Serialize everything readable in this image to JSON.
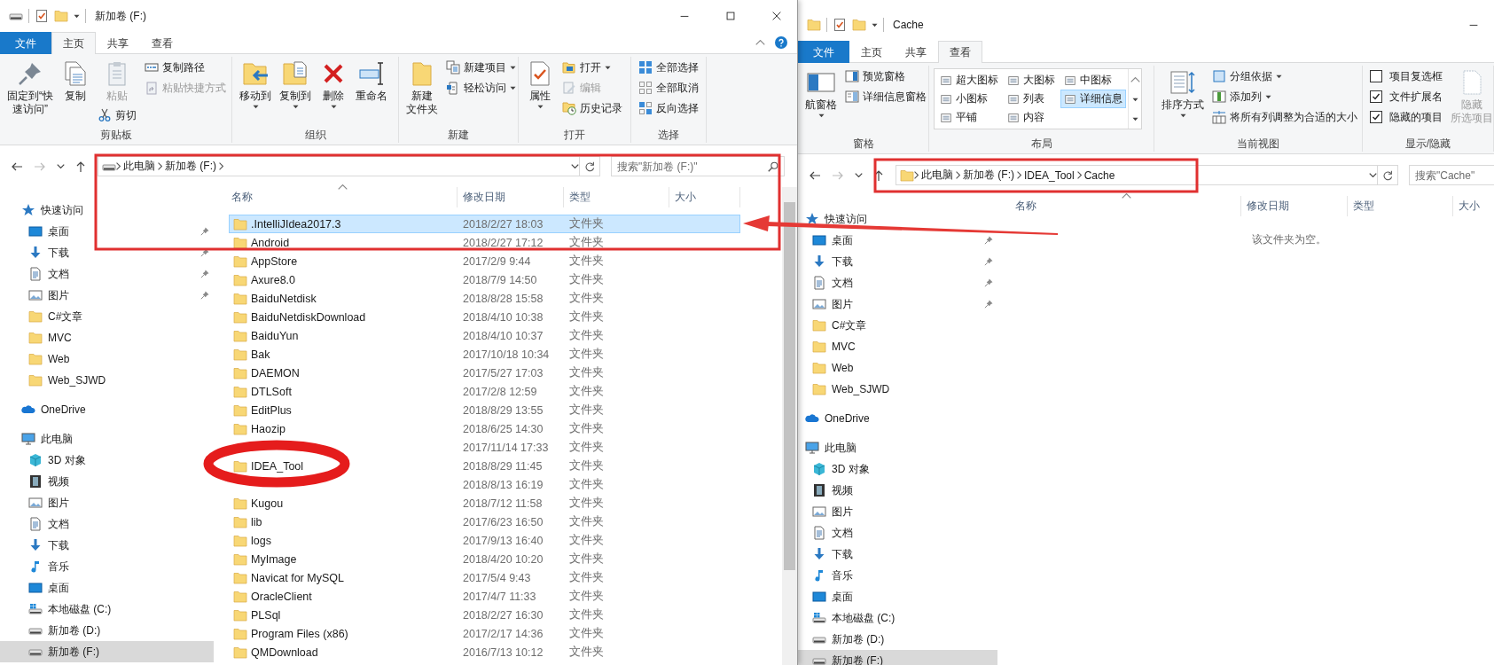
{
  "left_window": {
    "title": "新加卷 (F:)",
    "kind": "drive",
    "controls": [
      {
        "kind": "minimize"
      },
      {
        "kind": "maximize"
      },
      {
        "kind": "close"
      }
    ],
    "show_help": true,
    "tabs": [
      {
        "label": "文件",
        "kind": "file",
        "selected": false
      },
      {
        "label": "主页",
        "kind": "tab",
        "selected": true
      },
      {
        "label": "共享",
        "kind": "tab",
        "selected": false
      },
      {
        "label": "查看",
        "kind": "tab",
        "selected": false
      }
    ],
    "ribbon": [
      {
        "label": "剪贴板",
        "columns": [
          [
            {
              "lines": [
                "固定到“快",
                "速访问”"
              ],
              "kind": "large",
              "dropdown": false,
              "disabled": false
            }
          ],
          [
            {
              "label": "复制",
              "kind": "large",
              "dropdown": false,
              "disabled": false
            }
          ],
          [
            {
              "label": "粘贴",
              "kind": "large",
              "dropdown": false,
              "disabled": true
            },
            {
              "label": "剪切",
              "kind": "small",
              "dropdown": false,
              "disabled": false
            }
          ],
          [
            {
              "label": "复制路径",
              "kind": "small",
              "dropdown": false,
              "disabled": false
            },
            {
              "label": "粘贴快捷方式",
              "kind": "small",
              "dropdown": false,
              "disabled": true
            }
          ]
        ]
      },
      {
        "label": "组织",
        "columns": [
          [
            {
              "label": "移动到",
              "kind": "large",
              "dropdown": true,
              "disabled": false
            }
          ],
          [
            {
              "label": "复制到",
              "kind": "large",
              "dropdown": true,
              "disabled": false
            }
          ],
          [
            {
              "label": "删除",
              "kind": "large",
              "dropdown": true,
              "disabled": false
            }
          ],
          [
            {
              "label": "重命名",
              "kind": "large",
              "dropdown": false,
              "disabled": false
            }
          ]
        ]
      },
      {
        "label": "新建",
        "columns": [
          [
            {
              "lines": [
                "新建",
                "文件夹"
              ],
              "kind": "large",
              "dropdown": false,
              "disabled": false
            }
          ],
          [
            {
              "label": "新建项目",
              "kind": "small",
              "dropdown": true,
              "disabled": false
            },
            {
              "label": "轻松访问",
              "kind": "small",
              "dropdown": true,
              "disabled": false
            }
          ]
        ]
      },
      {
        "label": "打开",
        "columns": [
          [
            {
              "label": "属性",
              "kind": "large",
              "dropdown": true,
              "disabled": false
            }
          ],
          [
            {
              "label": "打开",
              "kind": "small",
              "dropdown": true,
              "disabled": false
            },
            {
              "label": "编辑",
              "kind": "small",
              "dropdown": false,
              "disabled": true
            },
            {
              "label": "历史记录",
              "kind": "small",
              "dropdown": false,
              "disabled": false
            }
          ]
        ]
      },
      {
        "label": "选择",
        "columns": [
          [
            {
              "label": "全部选择",
              "kind": "small",
              "dropdown": false,
              "disabled": false
            },
            {
              "label": "全部取消",
              "kind": "small",
              "dropdown": false,
              "disabled": false
            },
            {
              "label": "反向选择",
              "kind": "small",
              "dropdown": false,
              "disabled": false
            }
          ]
        ]
      }
    ],
    "address": {
      "crumbs": [
        "此电脑",
        "新加卷 (F:)"
      ],
      "trailing_chevron": true
    },
    "search": {
      "placeholder": "搜索\"新加卷 (F:)\""
    },
    "sidebar": [
      {
        "label": "快速访问",
        "kind": "quick-access",
        "selected": false,
        "pinned": false,
        "children": [
          {
            "label": "桌面",
            "kind": "desktop",
            "selected": false,
            "pinned": true
          },
          {
            "label": "下载",
            "kind": "downloads",
            "selected": false,
            "pinned": true
          },
          {
            "label": "文档",
            "kind": "documents",
            "selected": false,
            "pinned": true
          },
          {
            "label": "图片",
            "kind": "pictures",
            "selected": false,
            "pinned": true
          },
          {
            "label": "C#文章",
            "kind": "folder",
            "selected": false,
            "pinned": false
          },
          {
            "label": "MVC",
            "kind": "folder",
            "selected": false,
            "pinned": false
          },
          {
            "label": "Web",
            "kind": "folder",
            "selected": false,
            "pinned": false
          },
          {
            "label": "Web_SJWD",
            "kind": "folder",
            "selected": false,
            "pinned": false
          }
        ]
      },
      {
        "label": "OneDrive",
        "kind": "onedrive",
        "selected": false,
        "pinned": false
      },
      {
        "label": "此电脑",
        "kind": "computer",
        "selected": false,
        "pinned": false,
        "children": [
          {
            "label": "3D 对象",
            "kind": "objects",
            "selected": false,
            "pinned": false
          },
          {
            "label": "视频",
            "kind": "videos",
            "selected": false,
            "pinned": false
          },
          {
            "label": "图片",
            "kind": "pictures",
            "selected": false,
            "pinned": false
          },
          {
            "label": "文档",
            "kind": "documents",
            "selected": false,
            "pinned": false
          },
          {
            "label": "下载",
            "kind": "downloads",
            "selected": false,
            "pinned": false
          },
          {
            "label": "音乐",
            "kind": "music",
            "selected": false,
            "pinned": false
          },
          {
            "label": "桌面",
            "kind": "desktop",
            "selected": false,
            "pinned": false
          },
          {
            "label": "本地磁盘 (C:)",
            "kind": "sysdrive",
            "selected": false,
            "pinned": false
          },
          {
            "label": "新加卷 (D:)",
            "kind": "drive",
            "selected": false,
            "pinned": false
          },
          {
            "label": "新加卷 (F:)",
            "kind": "drive",
            "selected": true,
            "pinned": false
          }
        ]
      }
    ],
    "columns": [
      {
        "label": "名称",
        "sorted": true
      },
      {
        "label": "修改日期",
        "sorted": false
      },
      {
        "label": "类型",
        "sorted": false
      },
      {
        "label": "大小",
        "sorted": false
      }
    ],
    "rows": [
      {
        "name": ".IntelliJIdea2017.3",
        "modified": "2018/2/27 18:03",
        "type": "文件夹",
        "selected": true
      },
      {
        "name": "Android",
        "modified": "2018/2/27 17:12",
        "type": "文件夹",
        "selected": false
      },
      {
        "name": "AppStore",
        "modified": "2017/2/9 9:44",
        "type": "文件夹",
        "selected": false
      },
      {
        "name": "Axure8.0",
        "modified": "2018/7/9 14:50",
        "type": "文件夹",
        "selected": false
      },
      {
        "name": "BaiduNetdisk",
        "modified": "2018/8/28 15:58",
        "type": "文件夹",
        "selected": false
      },
      {
        "name": "BaiduNetdiskDownload",
        "modified": "2018/4/10 10:38",
        "type": "文件夹",
        "selected": false
      },
      {
        "name": "BaiduYun",
        "modified": "2018/4/10 10:37",
        "type": "文件夹",
        "selected": false
      },
      {
        "name": "Bak",
        "modified": "2017/10/18 10:34",
        "type": "文件夹",
        "selected": false
      },
      {
        "name": "DAEMON",
        "modified": "2017/5/27 17:03",
        "type": "文件夹",
        "selected": false
      },
      {
        "name": "DTLSoft",
        "modified": "2017/2/8 12:59",
        "type": "文件夹",
        "selected": false
      },
      {
        "name": "EditPlus",
        "modified": "2018/8/29 13:55",
        "type": "文件夹",
        "selected": false
      },
      {
        "name": "Haozip",
        "modified": "2018/6/25 14:30",
        "type": "文件夹",
        "selected": false
      },
      {
        "modified": "2017/11/14 17:33",
        "type": "文件夹",
        "selected": false
      },
      {
        "name": "IDEA_Tool",
        "modified": "2018/8/29 11:45",
        "type": "文件夹",
        "selected": false
      },
      {
        "modified": "2018/8/13 16:19",
        "type": "文件夹",
        "selected": false
      },
      {
        "name": "Kugou",
        "modified": "2018/7/12 11:58",
        "type": "文件夹",
        "selected": false
      },
      {
        "name": "lib",
        "modified": "2017/6/23 16:50",
        "type": "文件夹",
        "selected": false
      },
      {
        "name": "logs",
        "modified": "2017/9/13 16:40",
        "type": "文件夹",
        "selected": false
      },
      {
        "name": "MyImage",
        "modified": "2018/4/20 10:20",
        "type": "文件夹",
        "selected": false
      },
      {
        "name": "Navicat for MySQL",
        "modified": "2017/5/4 9:43",
        "type": "文件夹",
        "selected": false
      },
      {
        "name": "OracleClient",
        "modified": "2017/4/7 11:33",
        "type": "文件夹",
        "selected": false
      },
      {
        "name": "PLSql",
        "modified": "2018/2/27 16:30",
        "type": "文件夹",
        "selected": false
      },
      {
        "name": "Program Files (x86)",
        "modified": "2017/2/17 14:36",
        "type": "文件夹",
        "selected": false
      },
      {
        "name": "QMDownload",
        "modified": "2016/7/13 10:12",
        "type": "文件夹",
        "selected": false
      }
    ]
  },
  "right_window": {
    "title": "Cache",
    "kind": "folder",
    "controls": [
      {
        "kind": "minimize"
      }
    ],
    "show_help": false,
    "tabs": [
      {
        "label": "文件",
        "kind": "file",
        "selected": false
      },
      {
        "label": "主页",
        "kind": "tab",
        "selected": false
      },
      {
        "label": "共享",
        "kind": "tab",
        "selected": false
      },
      {
        "label": "查看",
        "kind": "tab",
        "selected": true
      }
    ],
    "ribbon": [
      {
        "label": "窗格",
        "columns": [
          [
            {
              "label": "航窗格",
              "kind": "large",
              "dropdown": true,
              "disabled": false
            }
          ],
          [
            {
              "label": "预览窗格",
              "kind": "small",
              "dropdown": false,
              "disabled": false
            },
            {
              "label": "详细信息窗格",
              "kind": "small",
              "dropdown": false,
              "disabled": false
            }
          ]
        ]
      },
      {
        "label": "布局",
        "columns": [
          [
            {
              "kind": "gallery",
              "options": [
                {
                  "label": "超大图标",
                  "selected": false
                },
                {
                  "label": "大图标",
                  "selected": false
                },
                {
                  "label": "中图标",
                  "selected": false
                },
                {
                  "label": "小图标",
                  "selected": false
                },
                {
                  "label": "列表",
                  "selected": false
                },
                {
                  "label": "详细信息",
                  "selected": true
                },
                {
                  "label": "平铺",
                  "selected": false
                },
                {
                  "label": "内容",
                  "selected": false
                }
              ]
            }
          ]
        ]
      },
      {
        "label": "当前视图",
        "columns": [
          [
            {
              "label": "排序方式",
              "kind": "large",
              "dropdown": true,
              "disabled": false
            }
          ],
          [
            {
              "label": "分组依据",
              "kind": "small",
              "dropdown": true,
              "disabled": false
            },
            {
              "label": "添加列",
              "kind": "small",
              "dropdown": true,
              "disabled": false
            },
            {
              "label": "将所有列调整为合适的大小",
              "kind": "small",
              "dropdown": false,
              "disabled": false
            }
          ]
        ]
      },
      {
        "label": "显示/隐藏",
        "columns": [
          [
            {
              "label": "项目复选框",
              "kind": "check",
              "checked": false
            },
            {
              "label": "文件扩展名",
              "kind": "check",
              "checked": true
            },
            {
              "label": "隐藏的项目",
              "kind": "check",
              "checked": true
            }
          ],
          [
            {
              "lines": [
                "隐藏",
                "所选项目"
              ],
              "kind": "large",
              "dropdown": false,
              "disabled": true
            }
          ]
        ]
      }
    ],
    "address": {
      "crumbs": [
        "此电脑",
        "新加卷 (F:)",
        "IDEA_Tool",
        "Cache"
      ],
      "trailing_chevron": false
    },
    "search": {
      "placeholder": "搜索\"Cache\""
    },
    "sidebar": [
      {
        "label": "快速访问",
        "kind": "quick-access",
        "selected": false,
        "pinned": false,
        "children": [
          {
            "label": "桌面",
            "kind": "desktop",
            "selected": false,
            "pinned": true
          },
          {
            "label": "下载",
            "kind": "downloads",
            "selected": false,
            "pinned": true
          },
          {
            "label": "文档",
            "kind": "documents",
            "selected": false,
            "pinned": true
          },
          {
            "label": "图片",
            "kind": "pictures",
            "selected": false,
            "pinned": true
          },
          {
            "label": "C#文章",
            "kind": "folder",
            "selected": false,
            "pinned": false
          },
          {
            "label": "MVC",
            "kind": "folder",
            "selected": false,
            "pinned": false
          },
          {
            "label": "Web",
            "kind": "folder",
            "selected": false,
            "pinned": false
          },
          {
            "label": "Web_SJWD",
            "kind": "folder",
            "selected": false,
            "pinned": false
          }
        ]
      },
      {
        "label": "OneDrive",
        "kind": "onedrive",
        "selected": false,
        "pinned": false
      },
      {
        "label": "此电脑",
        "kind": "computer",
        "selected": false,
        "pinned": false,
        "children": [
          {
            "label": "3D 对象",
            "kind": "objects",
            "selected": false,
            "pinned": false
          },
          {
            "label": "视频",
            "kind": "videos",
            "selected": false,
            "pinned": false
          },
          {
            "label": "图片",
            "kind": "pictures",
            "selected": false,
            "pinned": false
          },
          {
            "label": "文档",
            "kind": "documents",
            "selected": false,
            "pinned": false
          },
          {
            "label": "下载",
            "kind": "downloads",
            "selected": false,
            "pinned": false
          },
          {
            "label": "音乐",
            "kind": "music",
            "selected": false,
            "pinned": false
          },
          {
            "label": "桌面",
            "kind": "desktop",
            "selected": false,
            "pinned": false
          },
          {
            "label": "本地磁盘 (C:)",
            "kind": "sysdrive",
            "selected": false,
            "pinned": false
          },
          {
            "label": "新加卷 (D:)",
            "kind": "drive",
            "selected": false,
            "pinned": false
          },
          {
            "label": "新加卷 (F:)",
            "kind": "drive",
            "selected": true,
            "pinned": false
          }
        ]
      }
    ],
    "columns": [
      {
        "label": "名称",
        "sorted": true
      },
      {
        "label": "修改日期",
        "sorted": false
      },
      {
        "label": "类型",
        "sorted": false
      },
      {
        "label": "大小",
        "sorted": false
      }
    ],
    "empty_message": "该文件夹为空。"
  }
}
